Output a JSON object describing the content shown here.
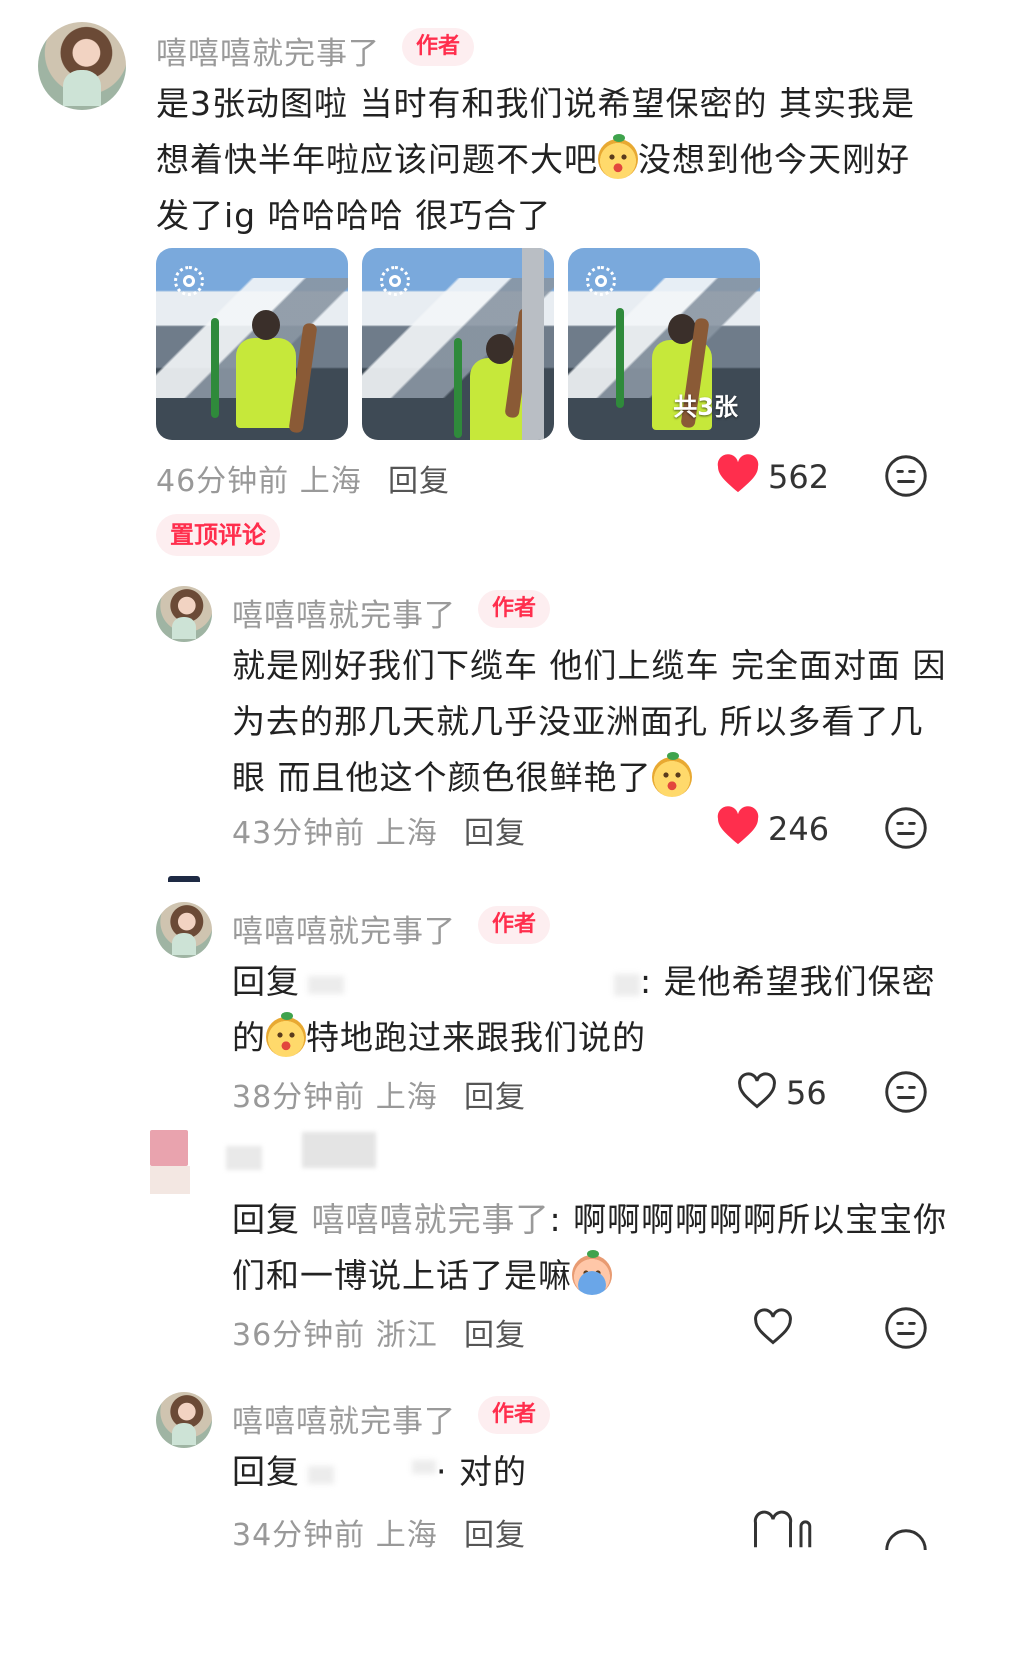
{
  "comments": [
    {
      "author": "嘻嘻嘻就完事了",
      "badge": "作者",
      "line1": "是3张动图啦 当时有和我们说希望保密的 其实我是",
      "line2a": "想着快半年啦应该问题不大吧",
      "line2b": "没想到他今天刚好",
      "line3": "发了ig 哈哈哈哈 很巧合了",
      "image_count_label": "共3张",
      "time": "46分钟前",
      "location": "上海",
      "reply_label": "回复",
      "likes": "562",
      "liked": true,
      "pinned_label": "置顶评论"
    },
    {
      "author": "嘻嘻嘻就完事了",
      "badge": "作者",
      "line1": "就是刚好我们下缆车 他们上缆车 完全面对面 因",
      "line2": "为去的那几天就几乎没亚洲面孔 所以多看了几",
      "line3": "眼 而且他这个颜色很鲜艳了",
      "time": "43分钟前",
      "location": "上海",
      "reply_label": "回复",
      "likes": "246",
      "liked": true
    },
    {
      "author": "嘻嘻嘻就完事了",
      "badge": "作者",
      "reply_prefix": "回复",
      "line1_tail": ": 是他希望我们保密",
      "line2a": "的",
      "line2b": "特地跑过来跟我们说的",
      "time": "38分钟前",
      "location": "上海",
      "reply_label": "回复",
      "likes": "56",
      "liked": false
    },
    {
      "reply_prefix": "回复",
      "reply_to": "嘻嘻嘻就完事了",
      "line1_tail": ": 啊啊啊啊啊啊所以宝宝你",
      "line2": "们和一博说上话了是嘛",
      "time": "36分钟前",
      "location": "浙江",
      "reply_label": "回复",
      "liked": false
    },
    {
      "author": "嘻嘻嘻就完事了",
      "badge": "作者",
      "reply_prefix": "回复",
      "line1_tail": "· 对的",
      "time": "34分钟前",
      "location": "上海",
      "reply_label": "回复"
    }
  ],
  "colors": {
    "accent": "#ff2e4d",
    "badge_bg": "#fdeef0",
    "muted": "#999999"
  },
  "icons": [
    "heart-filled-icon",
    "heart-outline-icon",
    "emoji-reaction-icon",
    "live-photo-icon"
  ]
}
